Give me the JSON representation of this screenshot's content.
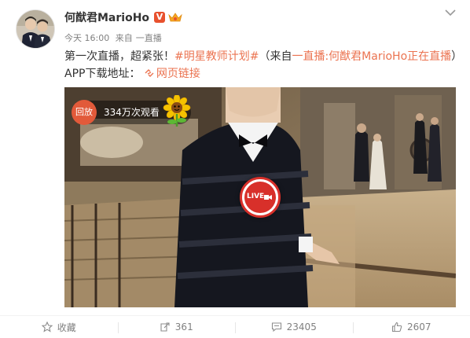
{
  "post": {
    "author": "何猷君MarioHo",
    "verified_badge": "V",
    "time": "今天 16:00",
    "source_prefix": "来自",
    "source": "一直播",
    "text": {
      "p1": "第一次直播，超紧张！",
      "hashtag": "#明星教师计划#",
      "p2": "（来自",
      "source_link": "一直播:何猷君MarioHo正在直播",
      "p3": "）APP下载地址：",
      "web_link": "网页链接"
    }
  },
  "video": {
    "replay_label": "回放",
    "views": "334万次观看",
    "live_label": "LIVE"
  },
  "actions": {
    "favorite": "收藏",
    "repost": "361",
    "comment": "23405",
    "like": "2607"
  },
  "colors": {
    "link": "#eb7350",
    "verified": "#e8512e",
    "live_red": "#d8302a",
    "meta_gray": "#808080"
  },
  "icons": [
    "verified-badge-icon",
    "crown-icon",
    "chevron-down-icon",
    "link-icon",
    "sunflower-icon",
    "live-camera-icon",
    "star-icon",
    "repost-icon",
    "comment-icon",
    "like-icon"
  ]
}
